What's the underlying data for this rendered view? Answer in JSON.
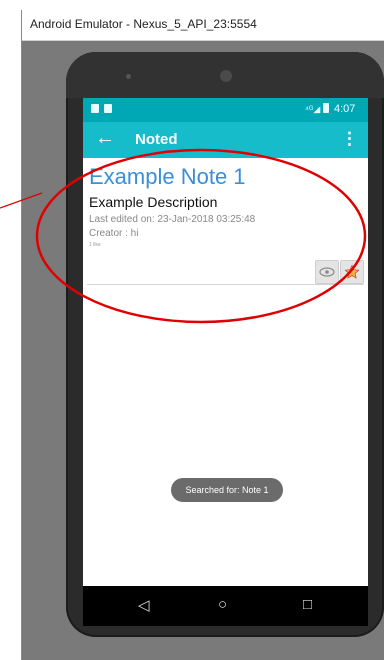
{
  "window": {
    "title": "Android Emulator - Nexus_5_API_23:5554"
  },
  "statusbar": {
    "time": "4:07",
    "signal": "⁴ᴳ◢"
  },
  "appbar": {
    "title": "Noted",
    "back_icon": "arrow-back-icon",
    "menu_icon": "overflow-menu-icon"
  },
  "note": {
    "title": "Example Note 1",
    "description": "Example Description",
    "edited": "Last edited on: 23-Jan-2018 03:25:48",
    "creator": "Creator : hi",
    "likes": "1 like"
  },
  "toast": {
    "text": "Searched for: Note 1"
  },
  "navbar": {
    "back": "◁",
    "home": "○",
    "recent": "□"
  },
  "colors": {
    "statusbar": "#00a8b5",
    "appbar": "#16bcc9",
    "title_blue": "#3a8fd8",
    "annotation": "#e00000"
  }
}
